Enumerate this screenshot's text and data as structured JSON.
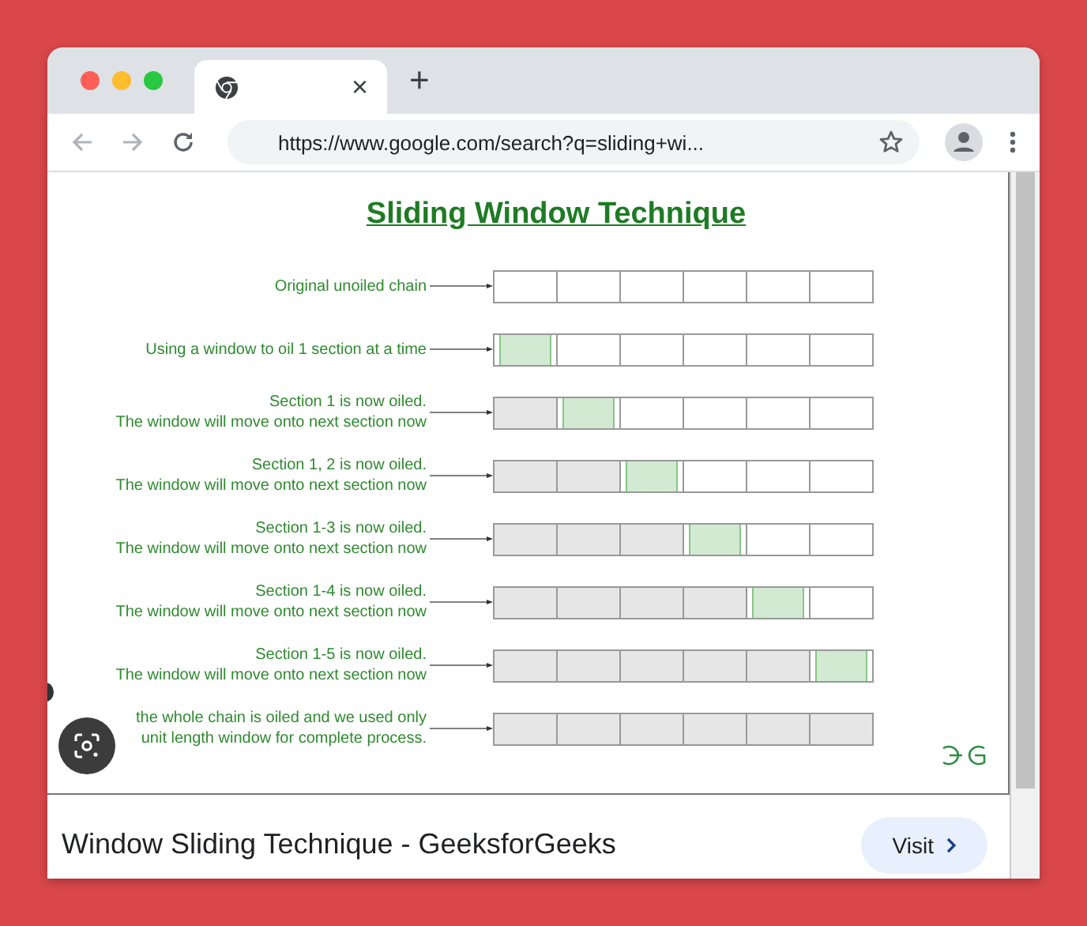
{
  "tab": {
    "close": "×"
  },
  "new_tab": "+",
  "address_bar": {
    "url": "https://www.google.com/search?q=sliding+wi..."
  },
  "diagram": {
    "title": "Sliding Window Technique",
    "rows": [
      {
        "lines": [
          "Original unoiled chain"
        ],
        "cells": [
          {
            "oiled": false,
            "window": false
          },
          {
            "oiled": false,
            "window": false
          },
          {
            "oiled": false,
            "window": false
          },
          {
            "oiled": false,
            "window": false
          },
          {
            "oiled": false,
            "window": false
          },
          {
            "oiled": false,
            "window": false
          }
        ]
      },
      {
        "lines": [
          "Using a window to oil 1 section at a time"
        ],
        "cells": [
          {
            "oiled": false,
            "window": true
          },
          {
            "oiled": false,
            "window": false
          },
          {
            "oiled": false,
            "window": false
          },
          {
            "oiled": false,
            "window": false
          },
          {
            "oiled": false,
            "window": false
          },
          {
            "oiled": false,
            "window": false
          }
        ]
      },
      {
        "lines": [
          "Section 1 is now oiled.",
          "The window will move onto next section now"
        ],
        "cells": [
          {
            "oiled": true,
            "window": false
          },
          {
            "oiled": false,
            "window": true
          },
          {
            "oiled": false,
            "window": false
          },
          {
            "oiled": false,
            "window": false
          },
          {
            "oiled": false,
            "window": false
          },
          {
            "oiled": false,
            "window": false
          }
        ]
      },
      {
        "lines": [
          "Section 1, 2 is now oiled.",
          "The window will move onto next section now"
        ],
        "cells": [
          {
            "oiled": true,
            "window": false
          },
          {
            "oiled": true,
            "window": false
          },
          {
            "oiled": false,
            "window": true
          },
          {
            "oiled": false,
            "window": false
          },
          {
            "oiled": false,
            "window": false
          },
          {
            "oiled": false,
            "window": false
          }
        ]
      },
      {
        "lines": [
          "Section 1-3 is now oiled.",
          "The window will move onto next section now"
        ],
        "cells": [
          {
            "oiled": true,
            "window": false
          },
          {
            "oiled": true,
            "window": false
          },
          {
            "oiled": true,
            "window": false
          },
          {
            "oiled": false,
            "window": true
          },
          {
            "oiled": false,
            "window": false
          },
          {
            "oiled": false,
            "window": false
          }
        ]
      },
      {
        "lines": [
          "Section 1-4 is now oiled.",
          "The window will move onto next section now"
        ],
        "cells": [
          {
            "oiled": true,
            "window": false
          },
          {
            "oiled": true,
            "window": false
          },
          {
            "oiled": true,
            "window": false
          },
          {
            "oiled": true,
            "window": false
          },
          {
            "oiled": false,
            "window": true
          },
          {
            "oiled": false,
            "window": false
          }
        ]
      },
      {
        "lines": [
          "Section 1-5 is now oiled.",
          "The window will move onto next section now"
        ],
        "cells": [
          {
            "oiled": true,
            "window": false
          },
          {
            "oiled": true,
            "window": false
          },
          {
            "oiled": true,
            "window": false
          },
          {
            "oiled": true,
            "window": false
          },
          {
            "oiled": true,
            "window": false
          },
          {
            "oiled": false,
            "window": true
          }
        ]
      },
      {
        "lines": [
          "the whole chain is oiled and we used only",
          "unit length window for complete process."
        ],
        "cells": [
          {
            "oiled": true,
            "window": false
          },
          {
            "oiled": true,
            "window": false
          },
          {
            "oiled": true,
            "window": false
          },
          {
            "oiled": true,
            "window": false
          },
          {
            "oiled": true,
            "window": false
          },
          {
            "oiled": true,
            "window": false
          }
        ]
      }
    ]
  },
  "result": {
    "title": "Window Sliding Technique - GeeksforGeeks",
    "button": "Visit"
  }
}
